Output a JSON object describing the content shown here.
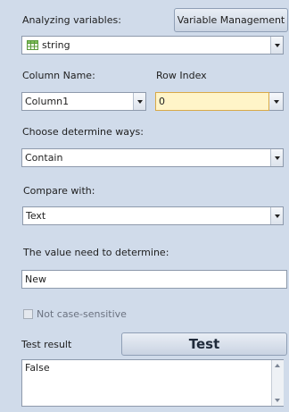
{
  "analyzing": {
    "label": "Analyzing variables:",
    "value": "string",
    "icon": "table-icon"
  },
  "variable_management": {
    "label": "Variable Management"
  },
  "column_name": {
    "label": "Column Name:",
    "value": "Column1"
  },
  "row_index": {
    "label": "Row Index",
    "value": "0"
  },
  "determine_ways": {
    "label": "Choose determine ways:",
    "value": "Contain"
  },
  "compare_with": {
    "label": "Compare with:",
    "value": "Text"
  },
  "value_to_determine": {
    "label": "The value need to determine:",
    "value": "New"
  },
  "case_option": {
    "label": "Not case-sensitive",
    "checked": false
  },
  "test": {
    "result_label": "Test result",
    "button_label": "Test",
    "result_text": "False"
  },
  "colors": {
    "panel_bg": "#d0dbea",
    "highlight_field": "#fff4c8",
    "field_border": "#8e9aac"
  }
}
